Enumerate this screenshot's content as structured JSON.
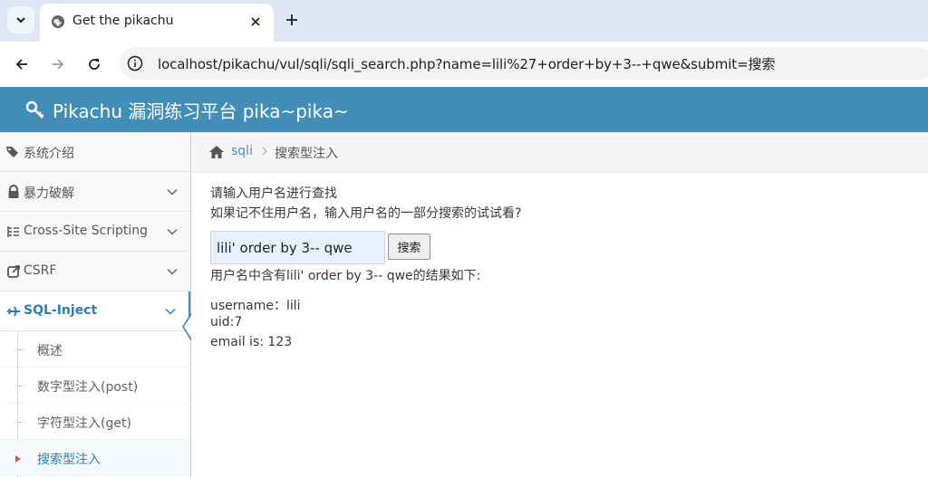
{
  "browser": {
    "tab_title": "Get the pikachu",
    "url": "localhost/pikachu/vul/sqli/sqli_search.php?name=lili%27+order+by+3--+qwe&submit=搜索"
  },
  "app": {
    "title": "Pikachu 漏洞练习平台 pika~pika~",
    "brand_color": "#438eb9"
  },
  "sidebar": {
    "items": [
      {
        "label": "系统介绍",
        "icon": "tags-icon"
      },
      {
        "label": "暴力破解",
        "icon": "lock-icon"
      },
      {
        "label": "Cross-Site Scripting",
        "icon": "list-icon"
      },
      {
        "label": "CSRF",
        "icon": "share-icon"
      },
      {
        "label": "SQL-Inject",
        "icon": "plane-icon"
      }
    ],
    "submenu": [
      {
        "label": "概述"
      },
      {
        "label": "数字型注入(post)"
      },
      {
        "label": "字符型注入(get)"
      },
      {
        "label": "搜索型注入"
      }
    ]
  },
  "breadcrumb": {
    "link": "sqli",
    "current": "搜索型注入"
  },
  "main": {
    "prompt_line1": "请输入用户名进行查找",
    "prompt_line2": "如果记不住用户名，输入用户名的一部分搜索的试试看?",
    "search_value": "lili' order by 3-- qwe",
    "search_button": "搜索",
    "result_header": "用户名中含有lili' order by 3-- qwe的结果如下:",
    "result_username": "username：lili",
    "result_uid": "uid:7",
    "result_email": "email is: 123"
  }
}
